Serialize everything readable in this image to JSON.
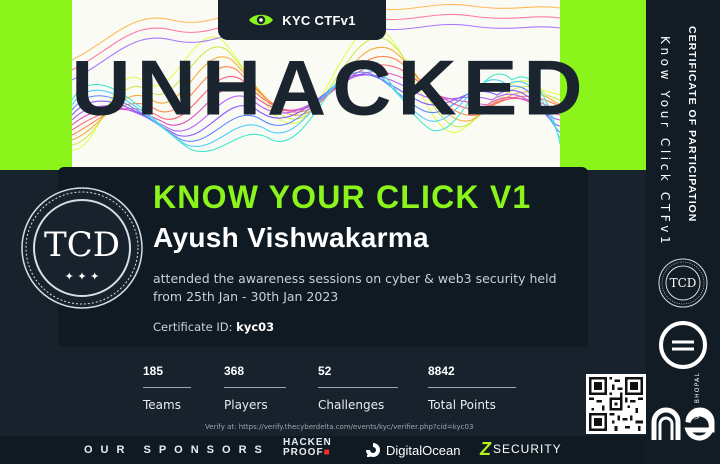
{
  "header": {
    "badge_label": "KYC CTFv1",
    "headline": "UNHACKED"
  },
  "certificate": {
    "event_title": "KNOW YOUR CLICK V1",
    "participant_name": "Ayush Vishwakarma",
    "description": "attended the awareness sessions on cyber & web3 security held from 25th Jan - 30th Jan 2023",
    "certificate_id_label": "Certificate ID:",
    "certificate_id_value": "kyc03"
  },
  "seal": {
    "text": "TCD"
  },
  "stats": [
    {
      "value": "185",
      "label": "Teams"
    },
    {
      "value": "368",
      "label": "Players"
    },
    {
      "value": "52",
      "label": "Challenges"
    },
    {
      "value": "8842",
      "label": "Total Points"
    }
  ],
  "verify_text": "Verify at: https://verify.thecyberdelta.com/events/kyc/verifier.php?cid=kyc03",
  "sponsors": {
    "title": "OUR SPONSORS",
    "hacken_line1": "HACKEN",
    "hacken_line2": "PROOF",
    "digitalocean": "DigitalOcean",
    "zsecurity_z": "Z",
    "zsecurity_rest": "SECURITY"
  },
  "sidebar": {
    "title": "CERTIFICATE OF PARTICIPATION",
    "subtitle": "Know Your Click CTFv1",
    "seal_text": "TCD",
    "vit_label": "VIT BHOPAL"
  },
  "colors": {
    "accent_green": "#8bf51b",
    "dark": "#17222c",
    "panel": "#0f1a22"
  },
  "icons": {
    "badge": "eye-icon",
    "digitalocean": "digitalocean-logo-icon"
  }
}
